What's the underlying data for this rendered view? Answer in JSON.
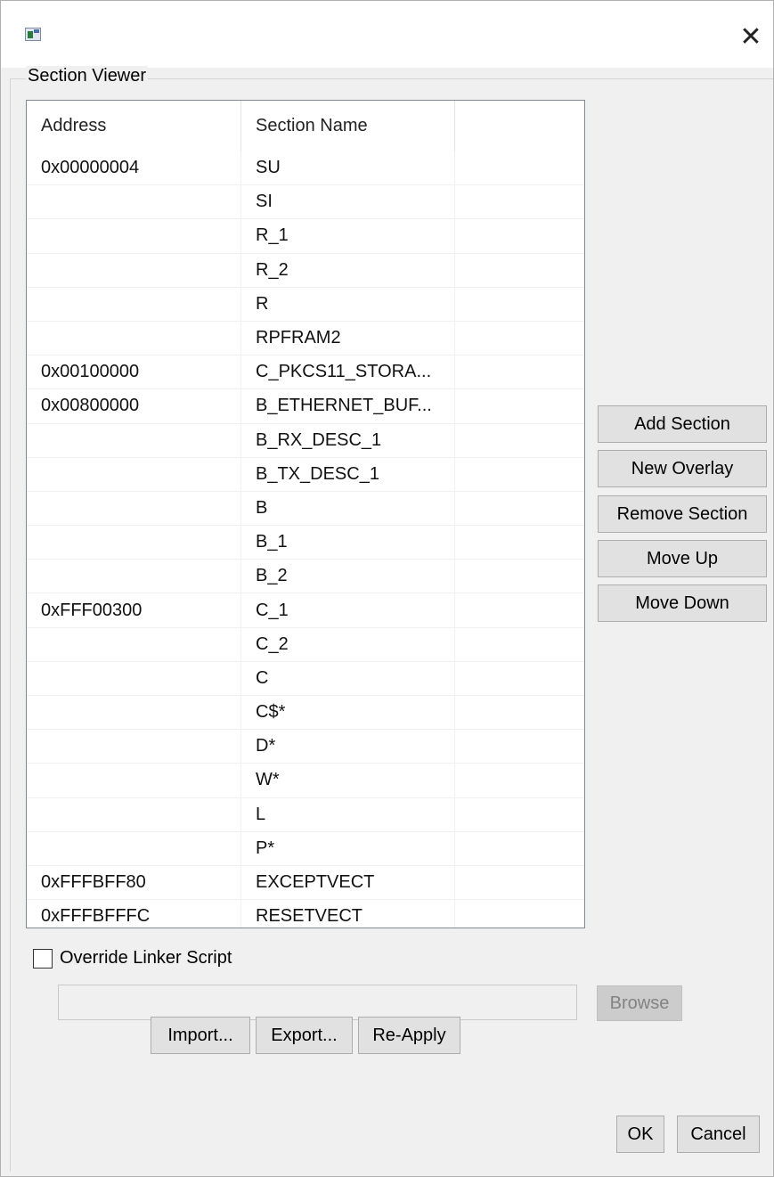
{
  "dialog": {
    "close_glyph": "✕"
  },
  "group": {
    "legend": "Section Viewer"
  },
  "table": {
    "columns": [
      "Address",
      "Section Name",
      ""
    ],
    "rows": [
      {
        "address": "0x00000004",
        "section": "SU"
      },
      {
        "address": "",
        "section": "SI"
      },
      {
        "address": "",
        "section": "R_1"
      },
      {
        "address": "",
        "section": "R_2"
      },
      {
        "address": "",
        "section": "R"
      },
      {
        "address": "",
        "section": "RPFRAM2"
      },
      {
        "address": "0x00100000",
        "section": "C_PKCS11_STORA..."
      },
      {
        "address": "0x00800000",
        "section": "B_ETHERNET_BUF..."
      },
      {
        "address": "",
        "section": "B_RX_DESC_1"
      },
      {
        "address": "",
        "section": "B_TX_DESC_1"
      },
      {
        "address": "",
        "section": "B"
      },
      {
        "address": "",
        "section": "B_1"
      },
      {
        "address": "",
        "section": "B_2"
      },
      {
        "address": "0xFFF00300",
        "section": "C_1"
      },
      {
        "address": "",
        "section": "C_2"
      },
      {
        "address": "",
        "section": "C"
      },
      {
        "address": "",
        "section": "C$*"
      },
      {
        "address": "",
        "section": "D*"
      },
      {
        "address": "",
        "section": "W*"
      },
      {
        "address": "",
        "section": "L"
      },
      {
        "address": "",
        "section": "P*"
      },
      {
        "address": "0xFFFBFF80",
        "section": "EXCEPTVECT"
      },
      {
        "address": "0xFFFBFFFC",
        "section": "RESETVECT"
      }
    ]
  },
  "side_buttons": {
    "add_section": "Add Section",
    "new_overlay": "New Overlay",
    "remove_section": "Remove Section",
    "move_up": "Move Up",
    "move_down": "Move Down"
  },
  "override": {
    "label": "Override Linker Script",
    "checked": false,
    "path_value": "",
    "browse": "Browse"
  },
  "bottom_buttons": {
    "import": "Import...",
    "export": "Export...",
    "reapply": "Re-Apply"
  },
  "dialog_buttons": {
    "ok": "OK",
    "cancel": "Cancel"
  }
}
